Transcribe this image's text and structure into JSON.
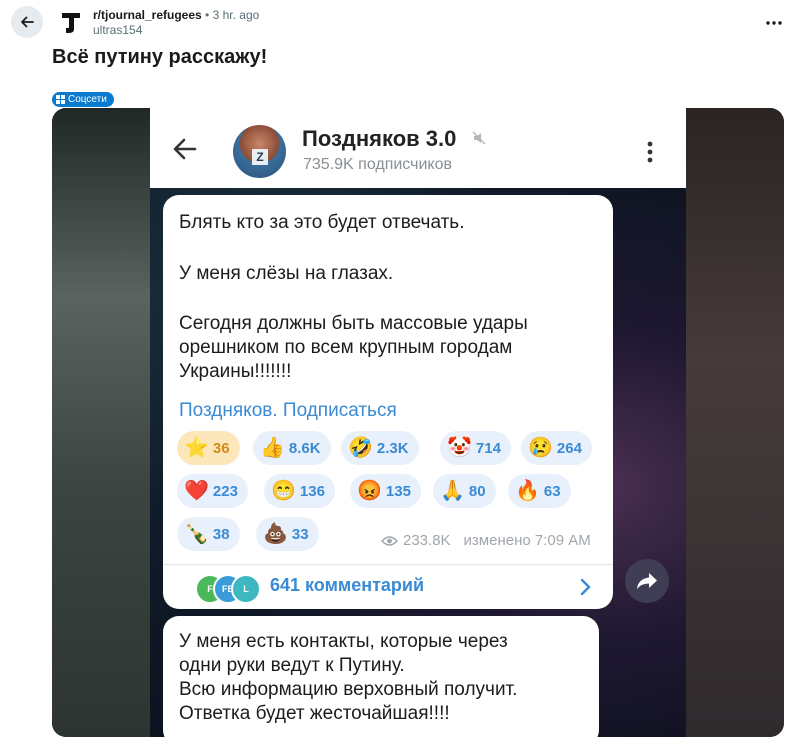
{
  "post": {
    "subreddit": "r/tjournal_refugees",
    "separator": "•",
    "time": "3 hr. ago",
    "author": "ultras154",
    "title": "Всё путину расскажу!",
    "flair_icon": "grid-icon",
    "flair": "Соцсети"
  },
  "telegram": {
    "channel_name": "Поздняков 3.0",
    "subscribers": "735.9K подписчиков",
    "message_lines": [
      "Блять кто за это будет отвечать.",
      "У меня слёзы на глазах.",
      "Сегодня должны быть массовые удары",
      "орешником по всем крупным городам",
      "Украины!!!!!!!"
    ],
    "subscribe_link": "Поздняков. Подписаться",
    "reactions": [
      {
        "emoji": "⭐",
        "count": "36"
      },
      {
        "emoji": "👍",
        "count": "8.6K"
      },
      {
        "emoji": "🤣",
        "count": "2.3K"
      },
      {
        "emoji": "🤡",
        "count": "714"
      },
      {
        "emoji": "😢",
        "count": "264"
      },
      {
        "emoji": "❤️",
        "count": "223"
      },
      {
        "emoji": "😁",
        "count": "136"
      },
      {
        "emoji": "😡",
        "count": "135"
      },
      {
        "emoji": "🙏",
        "count": "80"
      },
      {
        "emoji": "🔥",
        "count": "63"
      },
      {
        "emoji": "🍾",
        "count": "38"
      },
      {
        "emoji": "💩",
        "count": "33"
      }
    ],
    "views": "233.8K",
    "edited": "изменено 7:09 AM",
    "comment_avatars": [
      "F",
      "FB",
      "L"
    ],
    "comments_label": "641 комментарий",
    "message2_lines": [
      "У меня есть контакты, которые через",
      "одни руки ведут к Путину.",
      "Всю информацию верховный получит.",
      "Ответка будет жесточайшая!!!!"
    ]
  },
  "colors": {
    "accent": "#3a8ad4",
    "flair_bg": "#0a7bcf",
    "own_reaction_bg": "#fbe7b9"
  }
}
